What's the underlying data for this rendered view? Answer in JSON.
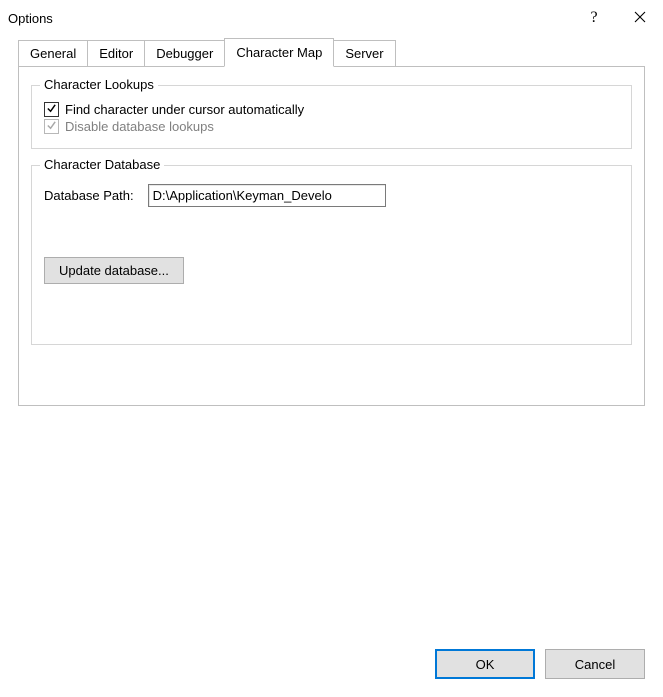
{
  "window": {
    "title": "Options"
  },
  "tabs": {
    "general": "General",
    "editor": "Editor",
    "debugger": "Debugger",
    "charmap": "Character Map",
    "server": "Server"
  },
  "charLookups": {
    "legend": "Character Lookups",
    "findAuto": {
      "label": "Find character under cursor automatically",
      "checked": true
    },
    "disableDbLookups": {
      "label": "Disable database lookups",
      "checked": true,
      "disabled": true
    }
  },
  "charDb": {
    "legend": "Character Database",
    "pathLabel": "Database Path:",
    "pathValue": "D:\\Application\\Keyman_Develo",
    "updateBtn": "Update database..."
  },
  "buttons": {
    "ok": "OK",
    "cancel": "Cancel"
  }
}
